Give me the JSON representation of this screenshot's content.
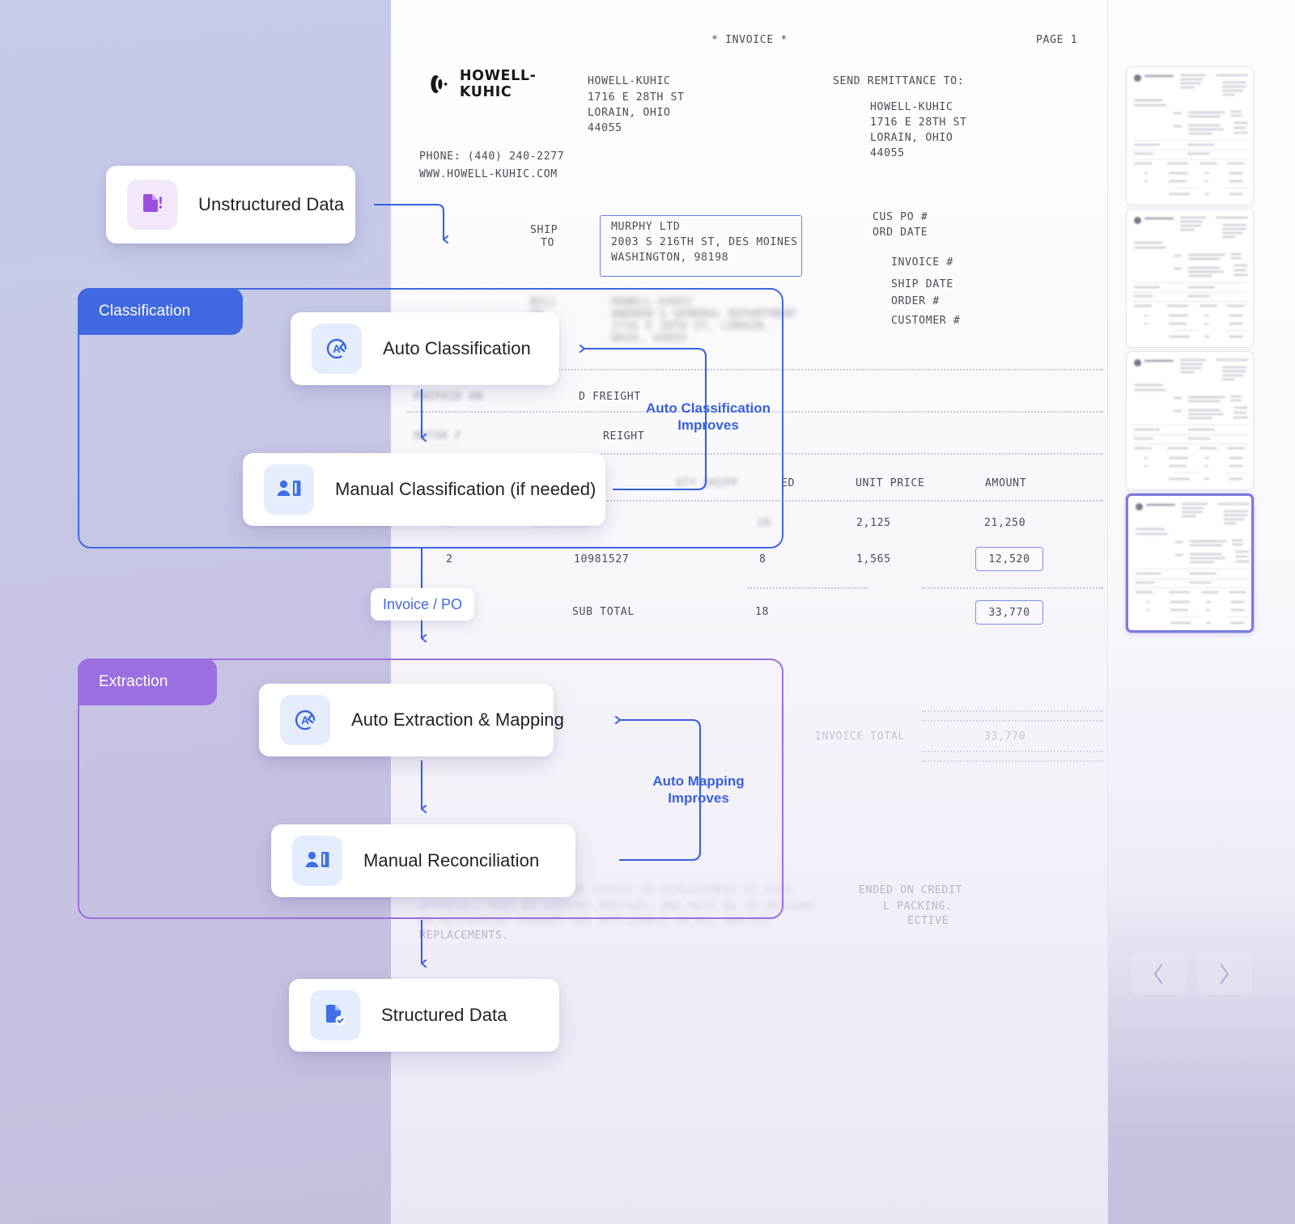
{
  "invoice": {
    "header_title": "* INVOICE *",
    "page_label": "PAGE 1",
    "logo_text": "HOWELL-KUHIC",
    "company": {
      "name": "HOWELL-KUHIC",
      "street": "1716 E 28TH ST",
      "city_state": "LORAIN, OHIO",
      "zip": "44055",
      "phone": "PHONE: (440) 240-2277",
      "website": "WWW.HOWELL-KUHIC.COM"
    },
    "remittance": {
      "label": "SEND REMITTANCE TO:",
      "name": "HOWELL-KUHIC",
      "street": "1716 E 28TH ST",
      "city_state": "LORAIN, OHIO",
      "zip": "44055"
    },
    "ship_to": {
      "label_line1": "SHIP",
      "label_line2": "TO",
      "name": "MURPHY LTD",
      "street": "2003 S 216TH ST, DES MOINES",
      "city_zip": "WASHINGTON, 98198"
    },
    "meta_fields": [
      "CUS PO #",
      "ORD DATE",
      "INVOICE #",
      "SHIP DATE",
      "ORDER #",
      "CUSTOMER #"
    ],
    "freight_rows": [
      "D FREIGHT",
      "REIGHT"
    ],
    "table_headers": [
      "ED",
      "UNIT PRICE",
      "AMOUNT"
    ],
    "rows": [
      {
        "line": "",
        "item": "",
        "qty": "",
        "unit_price": "2,125",
        "amount": "21,250",
        "amount_highlight": false
      },
      {
        "line": "2",
        "item": "10981527",
        "qty": "8",
        "unit_price": "1,565",
        "amount": "12,520",
        "amount_highlight": true
      }
    ],
    "subtotal": {
      "label": "SUB TOTAL",
      "qty": "18",
      "amount": "33,770",
      "highlight": true
    },
    "invoice_total": {
      "label": "INVOICE TOTAL",
      "amount": "33,770"
    },
    "footer_fragments": [
      "ENDED ON CREDIT",
      "L PACKING.",
      "ECTIVE",
      "REPLACEMENTS."
    ]
  },
  "flow": {
    "sections": [
      {
        "id": "classification",
        "label": "Classification",
        "color": "#4068e0"
      },
      {
        "id": "extraction",
        "label": "Extraction",
        "color": "#9b6fe0"
      }
    ],
    "nodes": [
      {
        "id": "unstructured",
        "label": "Unstructured Data",
        "icon": "document-alert-icon",
        "icon_tone": "violet"
      },
      {
        "id": "auto-classification",
        "label": "Auto Classification",
        "icon": "auto-circle-arrow-icon",
        "icon_tone": "blue"
      },
      {
        "id": "manual-classification",
        "label": "Manual Classification (if needed)",
        "icon": "person-panel-icon",
        "icon_tone": "blue"
      },
      {
        "id": "auto-extraction",
        "label": "Auto Extraction & Mapping",
        "icon": "auto-circle-arrow-icon",
        "icon_tone": "blue"
      },
      {
        "id": "manual-reconciliation",
        "label": "Manual Reconciliation",
        "icon": "person-panel-icon",
        "icon_tone": "blue"
      },
      {
        "id": "structured",
        "label": "Structured Data",
        "icon": "document-check-icon",
        "icon_tone": "blue"
      }
    ],
    "connector_pill": "Invoice / PO",
    "loop_labels": [
      {
        "id": "auto-classification-improves",
        "text": "Auto Classification\nImproves"
      },
      {
        "id": "auto-mapping-improves",
        "text": "Auto Mapping\nImproves"
      }
    ],
    "accent_blue": "#3761e0",
    "accent_purple": "#9b6fe0"
  },
  "rail": {
    "thumbnails": [
      {
        "index": 1,
        "selected": false
      },
      {
        "index": 2,
        "selected": false
      },
      {
        "index": 3,
        "selected": false
      },
      {
        "index": 4,
        "selected": true
      }
    ],
    "prev_label": "",
    "next_label": ""
  }
}
